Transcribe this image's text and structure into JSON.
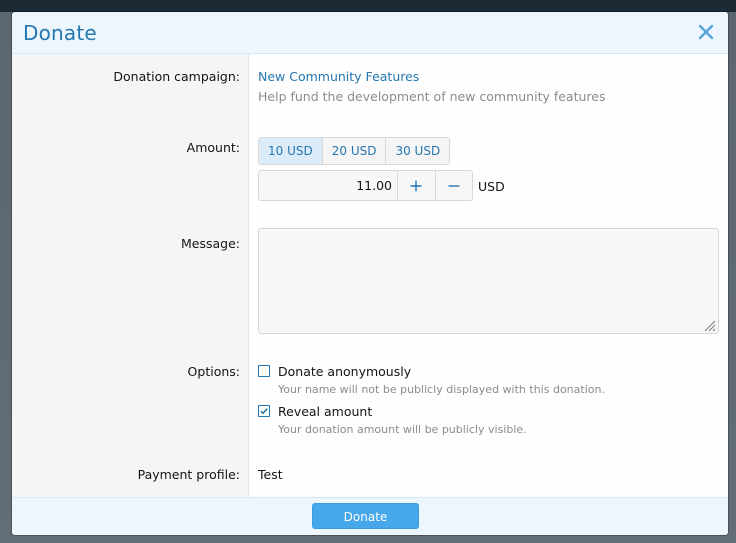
{
  "dialog": {
    "title": "Donate",
    "close_icon": "close-icon"
  },
  "fields": {
    "campaign_label": "Donation campaign:",
    "campaign_name": "New Community Features",
    "campaign_description": "Help fund the development of new community features",
    "amount_label": "Amount:",
    "amount_presets": [
      "10 USD",
      "20 USD",
      "30 USD"
    ],
    "amount_preset_selected": "10 USD",
    "amount_value": "11.00",
    "currency": "USD",
    "message_label": "Message:",
    "message_value": "",
    "options_label": "Options:",
    "payment_label": "Payment profile:",
    "payment_value": "Test"
  },
  "options": [
    {
      "label": "Donate anonymously",
      "hint": "Your name will not be publicly displayed with this donation.",
      "checked": false
    },
    {
      "label": "Reveal amount",
      "hint": "Your donation amount will be publicly visible.",
      "checked": true
    }
  ],
  "footer": {
    "donate_label": "Donate"
  },
  "colors": {
    "accent": "#2577b1",
    "button": "#47a7eb",
    "header_bg": "#edf6fd"
  }
}
